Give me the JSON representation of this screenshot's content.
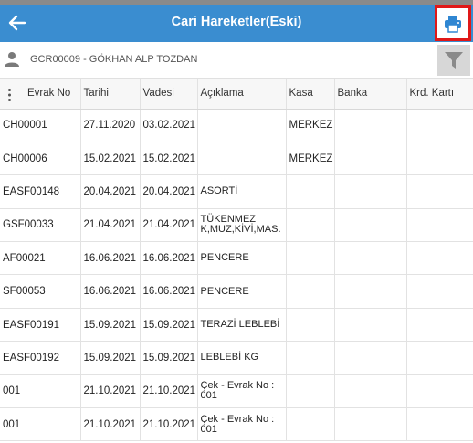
{
  "header": {
    "title": "Cari Hareketler(Eski)"
  },
  "customer": {
    "name": "GCR00009 - GÖKHAN ALP TOZDAN"
  },
  "table": {
    "columns": [
      "Evrak No",
      "Tarihi",
      "Vadesi",
      "Açıklama",
      "Kasa",
      "Banka",
      "Krd. Kartı"
    ],
    "rows": [
      [
        "CH00001",
        "27.11.2020",
        "03.02.2021",
        "",
        "MERKEZ",
        "",
        ""
      ],
      [
        "CH00006",
        "15.02.2021",
        "15.02.2021",
        "",
        "MERKEZ",
        "",
        ""
      ],
      [
        "EASF00148",
        "20.04.2021",
        "20.04.2021",
        "ASORTİ",
        "",
        "",
        ""
      ],
      [
        "GSF00033",
        "21.04.2021",
        "21.04.2021",
        "TÜKENMEZ K,MUZ,KİVİ,MAS.",
        "",
        "",
        ""
      ],
      [
        "AF00021",
        "16.06.2021",
        "16.06.2021",
        "PENCERE",
        "",
        "",
        ""
      ],
      [
        "SF00053",
        "16.06.2021",
        "16.06.2021",
        "PENCERE",
        "",
        "",
        ""
      ],
      [
        "EASF00191",
        "15.09.2021",
        "15.09.2021",
        "TERAZİ LEBLEBİ",
        "",
        "",
        ""
      ],
      [
        "EASF00192",
        "15.09.2021",
        "15.09.2021",
        "LEBLEBİ KG",
        "",
        "",
        ""
      ],
      [
        "001",
        "21.10.2021",
        "21.10.2021",
        "Çek - Evrak No : 001",
        "",
        "",
        ""
      ],
      [
        "001",
        "21.10.2021",
        "21.10.2021",
        "Çek - Evrak No : 001",
        "",
        "",
        ""
      ]
    ]
  }
}
